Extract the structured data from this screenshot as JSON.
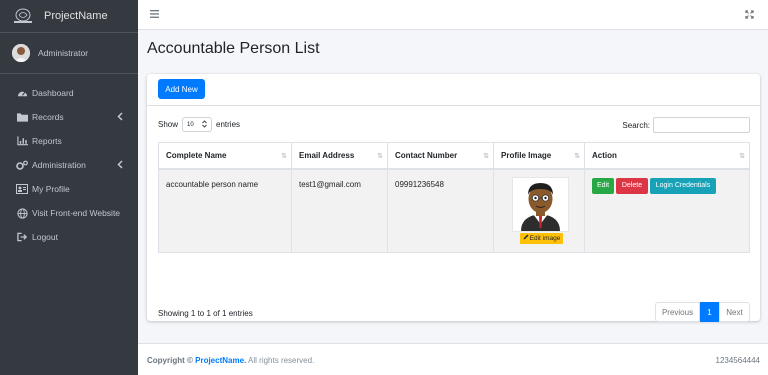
{
  "brand": {
    "name": "ProjectName"
  },
  "user": {
    "name": "Administrator"
  },
  "sidebar": {
    "items": [
      {
        "label": "Dashboard",
        "icon": "dashboard-icon"
      },
      {
        "label": "Records",
        "icon": "folder-icon",
        "has_children": true
      },
      {
        "label": "Reports",
        "icon": "chart-icon"
      },
      {
        "label": "Administration",
        "icon": "cogs-icon",
        "has_children": true
      },
      {
        "label": "My Profile",
        "icon": "id-card-icon"
      },
      {
        "label": "Visit Front-end Website",
        "icon": "globe-icon"
      },
      {
        "label": "Logout",
        "icon": "logout-icon"
      }
    ]
  },
  "page": {
    "title": "Accountable Person List"
  },
  "toolbar": {
    "add_label": "Add New"
  },
  "table_controls": {
    "show_label": "Show",
    "entries_value": "10",
    "entries_label": "entries",
    "search_label": "Search:",
    "search_value": ""
  },
  "table": {
    "columns": [
      "Complete Name",
      "Email Address",
      "Contact Number",
      "Profile Image",
      "Action"
    ],
    "rows": [
      {
        "name": "accountable person name",
        "email": "test1@gmail.com",
        "contact": "09991236548",
        "edit_image_label": "Edit image",
        "actions": {
          "edit": "Edit",
          "delete": "Delete",
          "login": "Login Credentials"
        }
      }
    ]
  },
  "pagination": {
    "info": "Showing 1 to 1 of 1 entries",
    "previous": "Previous",
    "current": "1",
    "next": "Next"
  },
  "footer": {
    "copyright_prefix": "Copyright ©",
    "project_name": "ProjectName.",
    "rights": "All rights reserved.",
    "version": "1234564444"
  },
  "colors": {
    "primary": "#007bff",
    "success": "#28a745",
    "danger": "#dc3545",
    "info": "#17a2b8",
    "warning": "#ffc107",
    "sidebar_bg": "#343a40"
  }
}
